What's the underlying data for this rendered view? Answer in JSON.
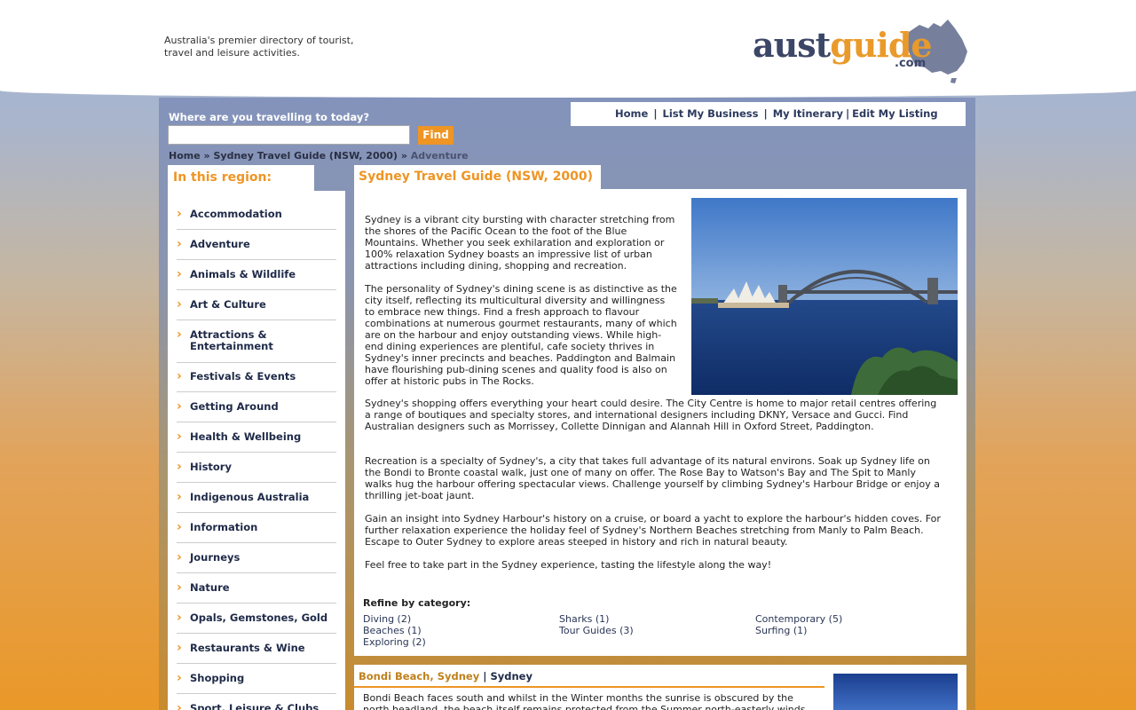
{
  "header": {
    "tagline_line1": "Australia's premier directory of tourist,",
    "tagline_line2": "travel and leisure activities.",
    "logo_aust": "aust",
    "logo_guide": "guide",
    "logo_com": ".com"
  },
  "nav": {
    "home": "Home",
    "list_business": "List My Business",
    "itinerary": "My Itinerary",
    "edit_listing": "Edit My Listing",
    "sep": "|"
  },
  "search": {
    "label": "Where are you travelling to today?",
    "value": "",
    "button": "Find"
  },
  "breadcrumb": {
    "home": "Home",
    "sep": "»",
    "guide": "Sydney Travel Guide (NSW, 2000)",
    "current": "Adventure"
  },
  "sidebar": {
    "title": "In this region:",
    "items": [
      "Accommodation",
      "Adventure",
      "Animals & Wildlife",
      "Art & Culture",
      "Attractions & Entertainment",
      "Festivals & Events",
      "Getting Around",
      "Health & Wellbeing",
      "History",
      "Indigenous Australia",
      "Information",
      "Journeys",
      "Nature",
      "Opals, Gemstones, Gold",
      "Restaurants & Wine",
      "Shopping",
      "Sport, Leisure & Clubs"
    ]
  },
  "main": {
    "title": "Sydney Travel Guide (NSW, 2000)",
    "paragraphs": [
      "Sydney is a vibrant city bursting with character stretching from the shores of the Pacific Ocean to the foot of the Blue Mountains. Whether you seek exhilaration and exploration or 100% relaxation Sydney boasts an impressive list of urban attractions including dining, shopping and recreation.",
      "The personality of Sydney's dining scene is as distinctive as the city itself, reflecting its multicultural diversity and willingness to embrace new things. Find a fresh approach to flavour combinations at numerous gourmet restaurants, many of which are on the harbour and enjoy outstanding views. While high-end dining experiences are plentiful, cafe society thrives in Sydney's inner precincts and beaches. Paddington and Balmain have flourishing pub-dining scenes and quality food is also on offer at historic pubs in The Rocks.",
      "Sydney's shopping offers everything your heart could desire. The City Centre is home to major retail centres offering a range of boutiques and specialty stores, and international designers including DKNY, Versace and Gucci. Find Australian designers such as Morrissey, Collette Dinnigan and Alannah Hill in Oxford Street, Paddington.",
      "Recreation is a specialty of Sydney's, a city that takes full advantage of its natural environs. Soak up Sydney life on the Bondi to Bronte coastal walk, just one of many on offer. The Rose Bay to Watson's Bay and The Spit to Manly walks hug the harbour offering spectacular views. Challenge yourself by climbing Sydney's Harbour Bridge or enjoy a thrilling jet-boat jaunt.",
      "Gain an insight into Sydney Harbour's history on a cruise, or board a yacht to explore the harbour's hidden coves. For further relaxation experience the holiday feel of Sydney's Northern Beaches stretching from Manly to Palm Beach. Escape to Outer Sydney to explore areas steeped in history and rich in natural beauty.",
      "Feel free to take part in the Sydney experience, tasting the lifestyle along the way!"
    ],
    "refine_label": "Refine by category:",
    "categories": [
      "Diving (2)",
      "Beaches (1)",
      "Exploring (2)",
      "Sharks (1)",
      "Tour Guides (3)",
      "Contemporary (5)",
      "Surfing (1)"
    ]
  },
  "listing": {
    "name": "Bondi Beach, Sydney",
    "sep": "|",
    "location": "Sydney",
    "text": "Bondi Beach faces south and whilst in the Winter months the sunrise is obscured by the north headland, the beach itself remains protected from the Summer north-easterly winds."
  }
}
